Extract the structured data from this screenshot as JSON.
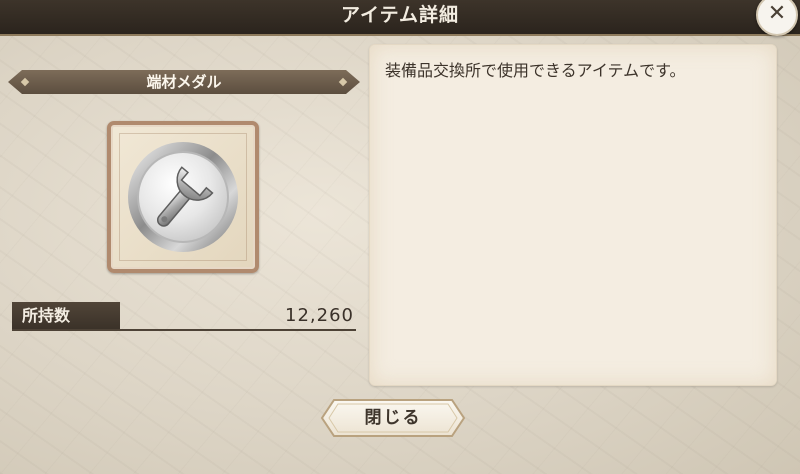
{
  "header": {
    "title": "アイテム詳細"
  },
  "close_icon": "close-icon",
  "item": {
    "name": "端材メダル",
    "icon": "wrench-icon",
    "owned_label": "所持数",
    "owned_count": "12,260"
  },
  "description": "装備品交換所で使用できるアイテムです。",
  "footer": {
    "close_label": "閉じる"
  },
  "colors": {
    "header_bg": "#2f2820",
    "banner": "#6a5a49",
    "frame": "#b08a6e",
    "panel": "#f4ede1",
    "text": "#3d342b"
  }
}
